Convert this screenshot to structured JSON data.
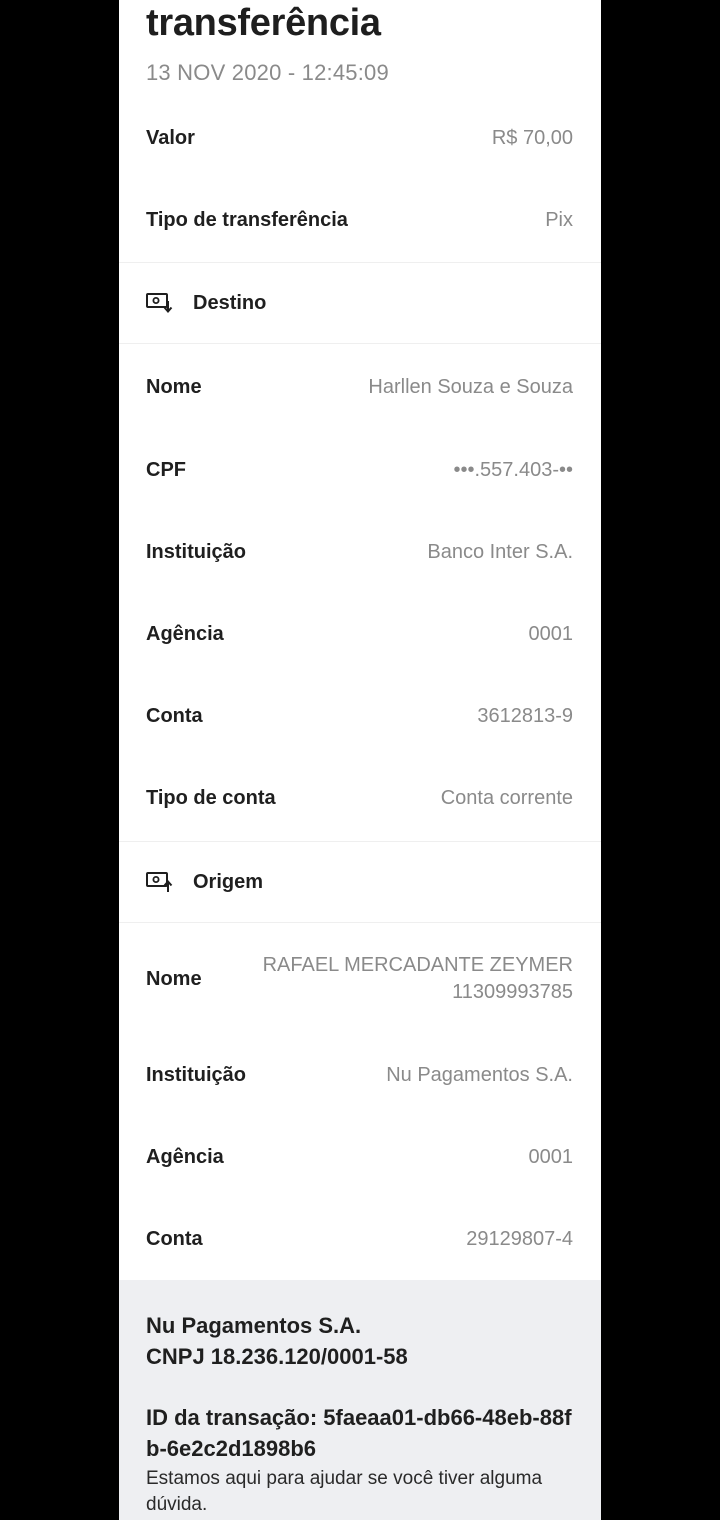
{
  "header": {
    "title": "transferência",
    "datetime": "13 NOV 2020 - 12:45:09"
  },
  "summary": [
    {
      "label": "Valor",
      "value": "R$ 70,00"
    },
    {
      "label": "Tipo de transferência",
      "value": "Pix"
    }
  ],
  "destino": {
    "title": "Destino",
    "icon": "receive-money-icon",
    "rows": [
      {
        "label": "Nome",
        "value": "Harllen Souza e Souza"
      },
      {
        "label": "CPF",
        "value": "•••.557.403-••"
      },
      {
        "label": "Instituição",
        "value": "Banco Inter S.A."
      },
      {
        "label": "Agência",
        "value": "0001"
      },
      {
        "label": "Conta",
        "value": "3612813-9"
      },
      {
        "label": "Tipo de conta",
        "value": "Conta corrente"
      }
    ]
  },
  "origem": {
    "title": "Origem",
    "icon": "send-money-icon",
    "rows": [
      {
        "label": "Nome",
        "value_line1": "RAFAEL MERCADANTE ZEYMER",
        "value_line2": "11309993785"
      },
      {
        "label": "Instituição",
        "value": "Nu Pagamentos S.A."
      },
      {
        "label": "Agência",
        "value": "0001"
      },
      {
        "label": "Conta",
        "value": "29129807-4"
      }
    ]
  },
  "footer": {
    "company_name": "Nu Pagamentos S.A.",
    "cnpj": "CNPJ 18.236.120/0001-58",
    "transaction_id": "ID da transação: 5faeaa01-db66-48eb-88fb-6e2c2d1898b6",
    "help_text": "Estamos aqui para ajudar se você tiver alguma dúvida."
  }
}
